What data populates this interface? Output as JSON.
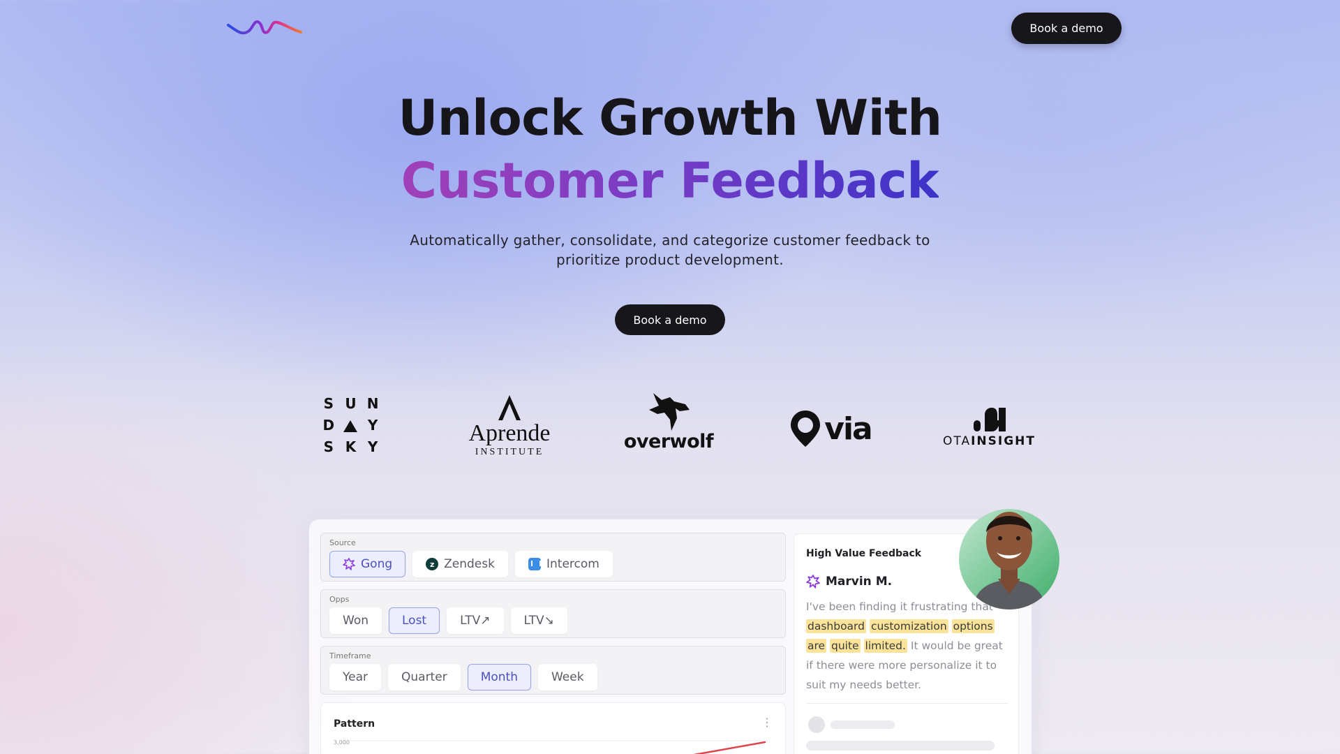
{
  "header": {
    "logo": "wave-logo",
    "cta_label": "Book a demo"
  },
  "hero": {
    "title_line1": "Unlock Growth With",
    "title_line2": "Customer Feedback",
    "subtitle": "Automatically gather, consolidate, and categorize customer feedback to prioritize product development.",
    "cta_label": "Book a demo",
    "gradient": [
      "#a040b8",
      "#3d33c8"
    ]
  },
  "logos": {
    "sunday_letters": [
      "S",
      "U",
      "N",
      "D",
      "",
      "Y",
      "S",
      "K",
      "Y"
    ],
    "aprende_name": "Aprende",
    "aprende_sub": "INSTITUTE",
    "overwolf_name": "overwolf",
    "via_name": "via",
    "ota_name_light": "OTA",
    "ota_name_bold": "INSIGHT"
  },
  "dashboard": {
    "source": {
      "label": "Source",
      "options": [
        {
          "label": "Gong",
          "icon": "gong-icon",
          "selected": true
        },
        {
          "label": "Zendesk",
          "icon": "zendesk-icon",
          "selected": false
        },
        {
          "label": "Intercom",
          "icon": "intercom-icon",
          "selected": false
        }
      ]
    },
    "opps": {
      "label": "Opps",
      "options": [
        {
          "label": "Won",
          "selected": false
        },
        {
          "label": "Lost",
          "selected": true
        },
        {
          "label": "LTV↗",
          "selected": false
        },
        {
          "label": "LTV↘",
          "selected": false
        }
      ]
    },
    "timeframe": {
      "label": "Timeframe",
      "options": [
        {
          "label": "Year",
          "selected": false
        },
        {
          "label": "Quarter",
          "selected": false
        },
        {
          "label": "Month",
          "selected": true
        },
        {
          "label": "Week",
          "selected": false
        }
      ]
    },
    "pattern": {
      "title": "Pattern",
      "menu": "⋮",
      "tick_top": "3,000",
      "line_color": "#e0454d"
    }
  },
  "feedback": {
    "title": "High Value Feedback",
    "user_name": "Marvin M.",
    "quote_before": "I've been finding it frustrating that",
    "highlights": [
      "dashboard",
      "customization",
      "options",
      "are",
      "quite",
      "limited."
    ],
    "quote_after": "It would be great if there were more personalize it to suit my needs better.",
    "highlight_color": "#fbe49a"
  },
  "colors": {
    "accent_selected": "#4a50c0",
    "button_dark": "#17161b"
  }
}
